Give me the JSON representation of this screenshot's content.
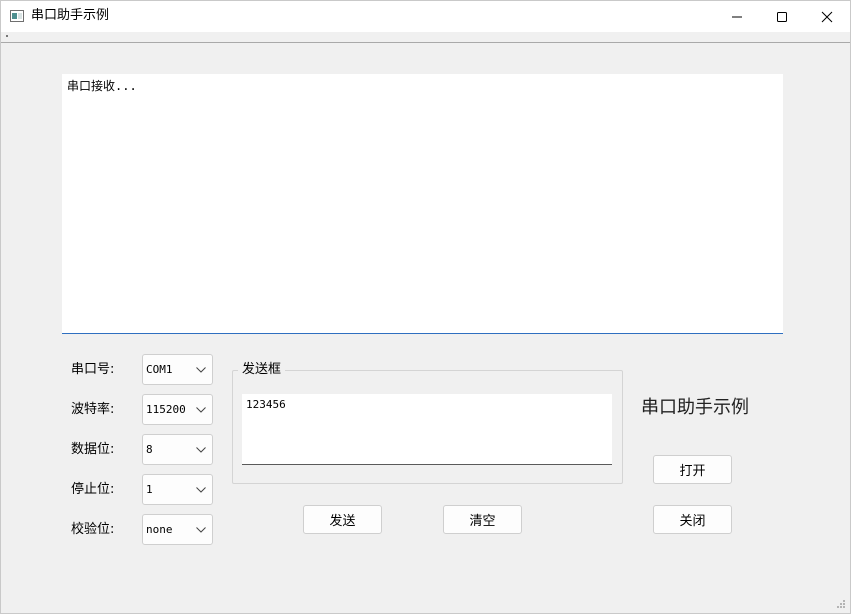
{
  "window": {
    "title": "串口助手示例"
  },
  "receive": {
    "text": "串口接收..."
  },
  "settings": [
    {
      "label": "串口号:",
      "value": "COM1"
    },
    {
      "label": "波特率:",
      "value": "115200"
    },
    {
      "label": "数据位:",
      "value": "8"
    },
    {
      "label": "停止位:",
      "value": "1"
    },
    {
      "label": "校验位:",
      "value": "none"
    }
  ],
  "send_group": {
    "title": "发送框",
    "value": "123456"
  },
  "heading": "串口助手示例",
  "buttons": {
    "send": "发送",
    "clear": "清空",
    "open": "打开",
    "close": "关闭"
  },
  "icons": {
    "app": "app-window-icon",
    "minimize": "minimize-icon",
    "maximize": "maximize-icon",
    "close": "close-icon",
    "dropdown": "chevron-down-icon",
    "grip": "resize-grip-icon"
  },
  "colors": {
    "window_bg": "#f0f0f0",
    "focus_underline": "#2f6fc0"
  }
}
